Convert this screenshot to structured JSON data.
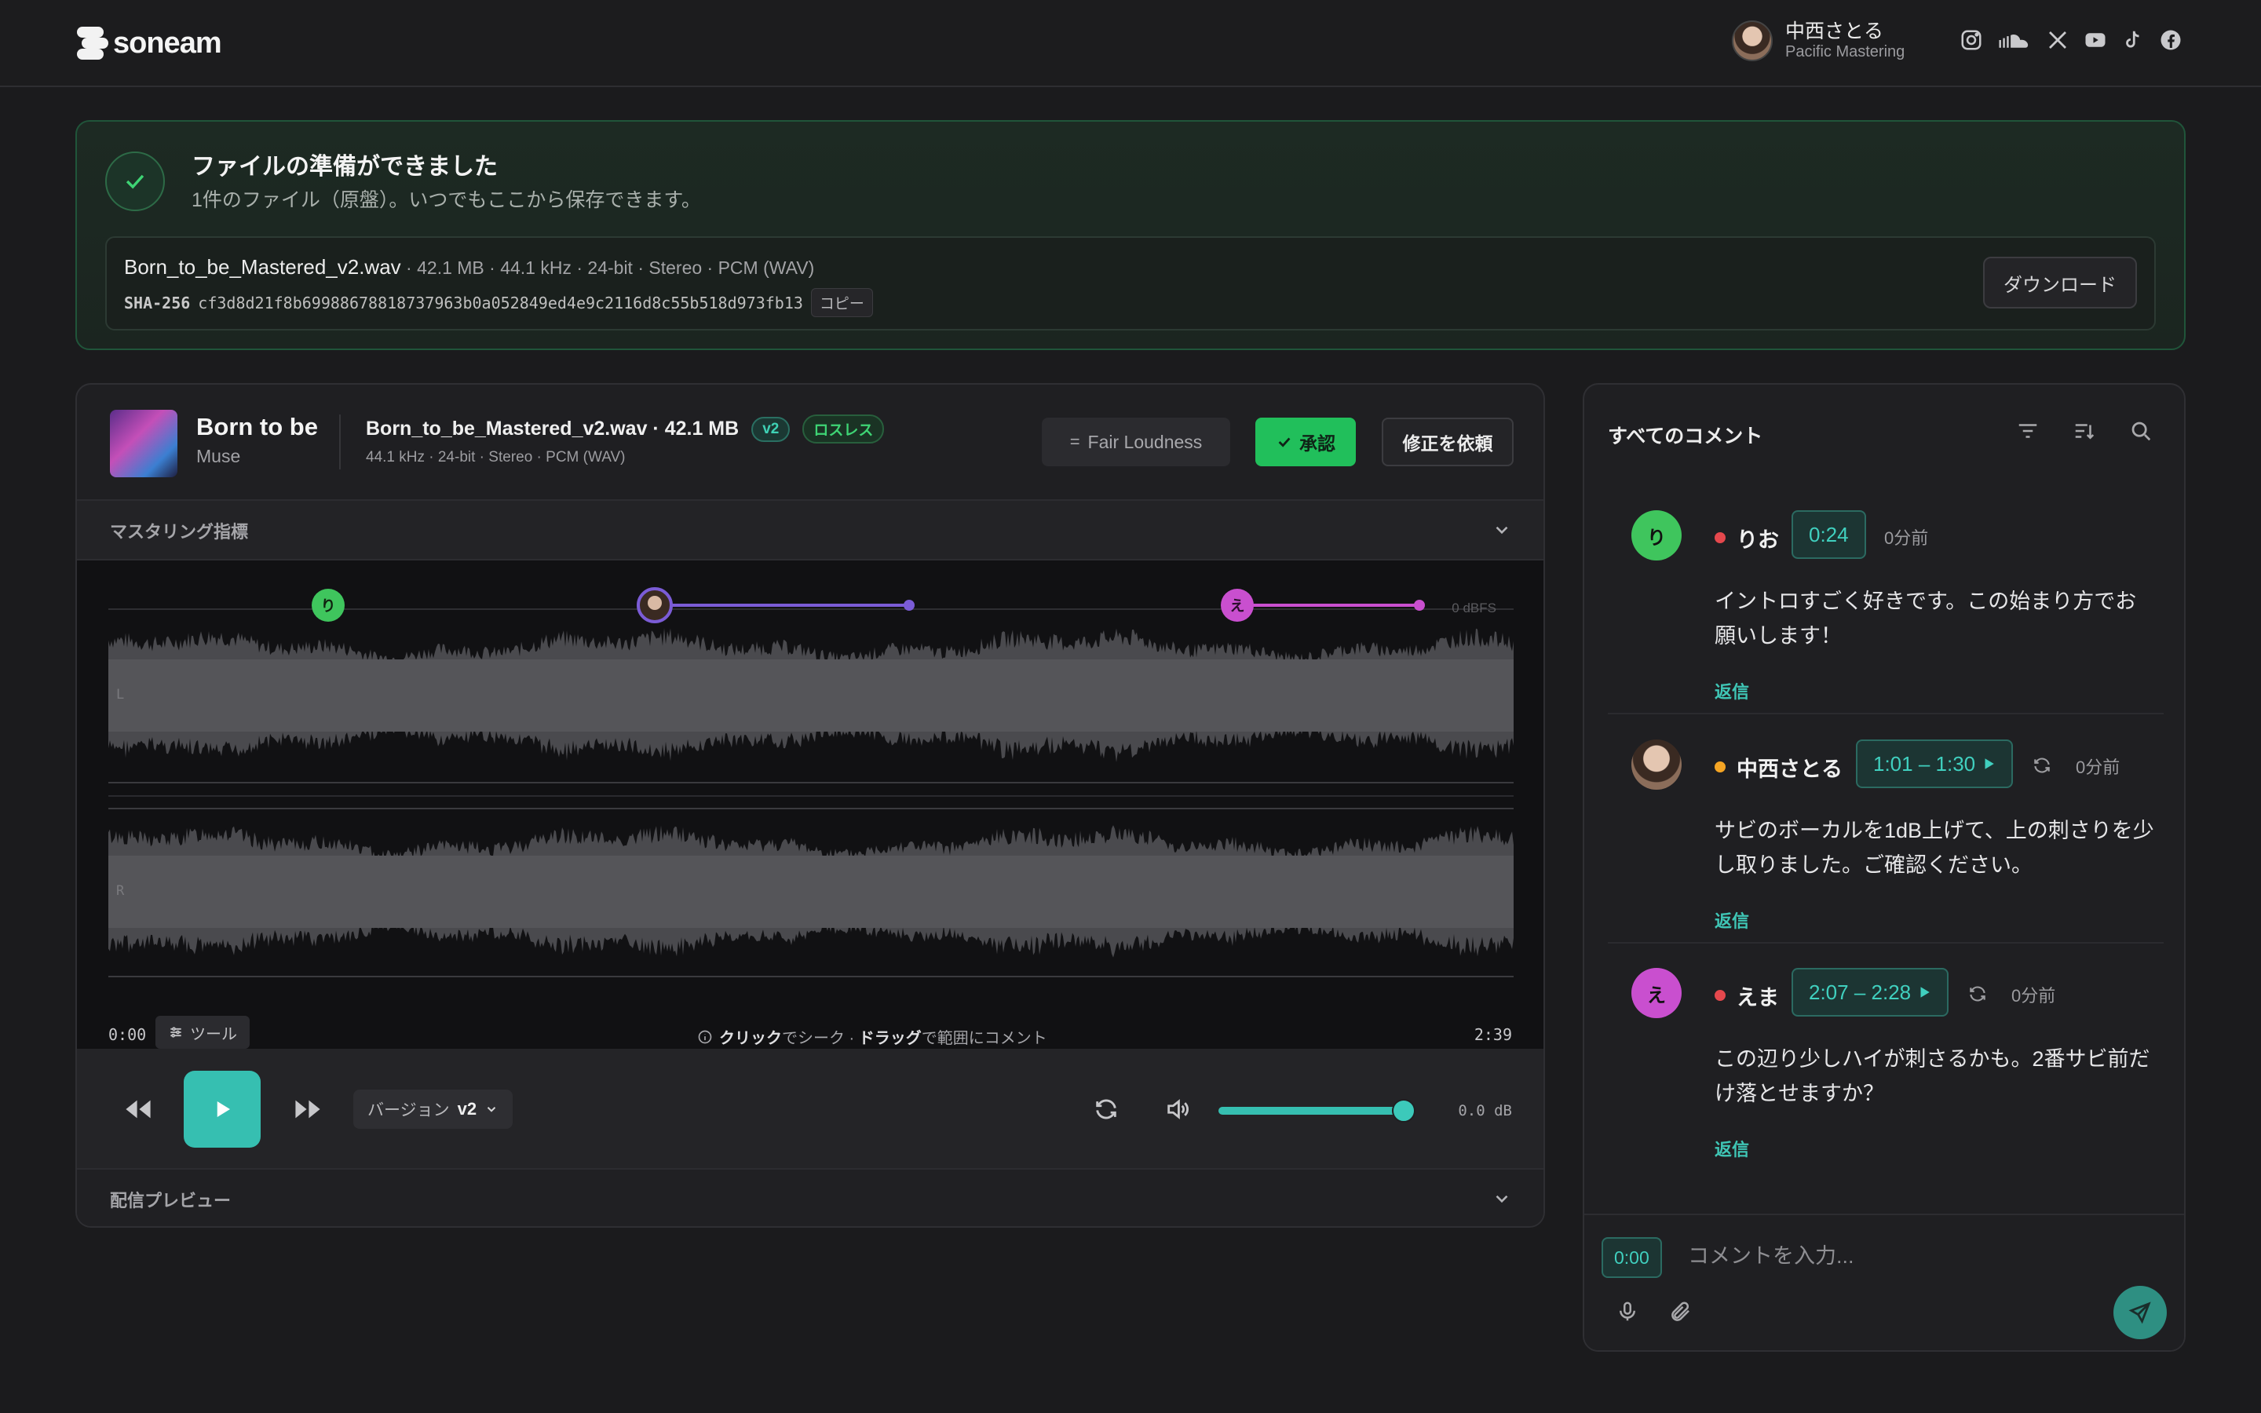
{
  "header": {
    "brand": "soneam",
    "user": {
      "name": "中西さとる",
      "org": "Pacific Mastering"
    },
    "socials": [
      "instagram-icon",
      "soundcloud-icon",
      "x-icon",
      "youtube-icon",
      "tiktok-icon",
      "facebook-icon"
    ]
  },
  "ready": {
    "title": "ファイルの準備ができました",
    "subtitle": "1件のファイル（原盤）。いつでもここから保存できます。",
    "file": {
      "name": "Born_to_be_Mastered_v2.wav",
      "meta": " · 42.1 MB · 44.1 kHz · 24-bit · Stereo · PCM (WAV)",
      "sha_label": "SHA-256",
      "sha": "cf3d8d21f8b69988678818737963b0a052849ed4e9c2116d8c55b518d973fb13",
      "copy_label": "コピー"
    },
    "download_label": "ダウンロード"
  },
  "player": {
    "track_title": "Born to be",
    "artist": "Muse",
    "file_name": "Born_to_be_Mastered_v2.wav · 42.1 MB",
    "version_badge": "v2",
    "lossless_badge": "ロスレス",
    "file_meta": "44.1 kHz · 24-bit · Stereo · PCM (WAV)",
    "fair_label": "Fair Loudness",
    "approve_label": "承認",
    "revise_label": "修正を依頼",
    "metrics_label": "マスタリング指標",
    "wave": {
      "dbfs_label": "0 dBFS",
      "channel_l": "L",
      "channel_r": "R",
      "markers": [
        {
          "initial": "り",
          "color": "#3fc55d",
          "start": "0:24"
        },
        {
          "initial": "",
          "color": "#7b5cd6",
          "start": "1:01",
          "end": "1:30"
        },
        {
          "initial": "え",
          "color": "#c94fcf",
          "start": "2:07",
          "end": "2:28"
        }
      ]
    },
    "time_start": "0:00",
    "time_end": "2:39",
    "tool_label": "ツール",
    "hint": {
      "click": "クリック",
      "seek": "でシーク · ",
      "drag": "ドラッグ",
      "range": "で範囲にコメント"
    },
    "version_label": "バージョン",
    "version_value": "v2",
    "volume_fraction": 0.96,
    "db_readout": "0.0 dB",
    "preview_label": "配信プレビュー"
  },
  "comments": {
    "title": "すべてのコメント",
    "items": [
      {
        "initial": "り",
        "avatar_color": "#3fc55d",
        "status_color": "#e5484d",
        "name": "りお",
        "time": "0:24",
        "has_play": false,
        "has_loop": false,
        "ago": "0分前",
        "body": "イントロすごく好きです。この始まり方でお願いします！",
        "reply": "返信"
      },
      {
        "initial": "",
        "avatar_color": "photo",
        "status_color": "#f5a524",
        "name": "中西さとる",
        "time": "1:01 – 1:30",
        "has_play": true,
        "has_loop": true,
        "ago": "0分前",
        "body": "サビのボーカルを1dB上げて、上の刺さりを少し取りました。ご確認ください。",
        "reply": "返信"
      },
      {
        "initial": "え",
        "avatar_color": "#c94fcf",
        "status_color": "#e5484d",
        "name": "えま",
        "time": "2:07 – 2:28",
        "has_play": true,
        "has_loop": true,
        "ago": "0分前",
        "body": "この辺り少しハイが刺さるかも。2番サビ前だけ落とせますか？",
        "reply": "返信"
      }
    ],
    "input": {
      "time": "0:00",
      "placeholder": "コメントを入力..."
    }
  }
}
